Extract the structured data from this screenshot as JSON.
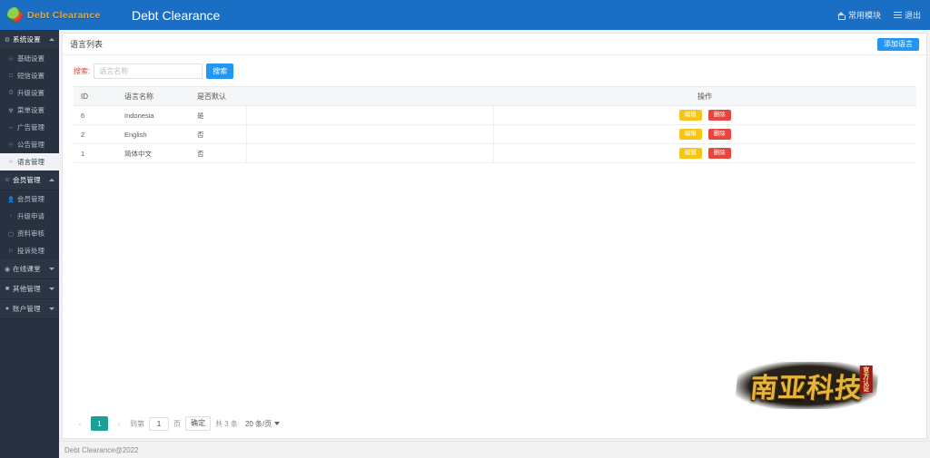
{
  "header": {
    "logo_text": "Debt Clearance",
    "title": "Debt Clearance",
    "nav": [
      {
        "label": "常用模块",
        "icon": "home-icon"
      },
      {
        "label": "退出",
        "icon": "bars-icon"
      }
    ]
  },
  "sidebar": {
    "groups": [
      {
        "label": "系统设置",
        "icon": "wrench-icon",
        "expanded": true,
        "items": [
          {
            "label": "基础设置",
            "icon": "gear-icon",
            "selected": false
          },
          {
            "label": "短信设置",
            "icon": "message-icon",
            "selected": false
          },
          {
            "label": "升级设置",
            "icon": "upgrade-icon",
            "selected": false
          },
          {
            "label": "菜单设置",
            "icon": "menu-icon",
            "selected": false
          },
          {
            "label": "广告管理",
            "icon": "ad-icon",
            "selected": false
          },
          {
            "label": "公告管理",
            "icon": "bell-icon",
            "selected": false
          },
          {
            "label": "语言管理",
            "icon": "globe-icon",
            "selected": true
          }
        ]
      },
      {
        "label": "会员管理",
        "icon": "user-icon",
        "expanded": true,
        "items": [
          {
            "label": "会员管理",
            "icon": "people-icon",
            "selected": false
          },
          {
            "label": "升级申请",
            "icon": "arrow-up-icon",
            "selected": false
          },
          {
            "label": "资料审核",
            "icon": "doc-icon",
            "selected": false
          },
          {
            "label": "投诉处理",
            "icon": "flag-icon",
            "selected": false
          }
        ]
      },
      {
        "label": "在线课堂",
        "icon": "play-icon",
        "expanded": false,
        "items": []
      },
      {
        "label": "其他管理",
        "icon": "grid-icon",
        "expanded": false,
        "items": []
      },
      {
        "label": "账户管理",
        "icon": "circle-icon",
        "expanded": false,
        "items": []
      }
    ]
  },
  "panel": {
    "title": "语言列表",
    "add_button": "添加语言"
  },
  "search": {
    "label": "搜索:",
    "placeholder": "语言名称",
    "value": "",
    "button": "搜索"
  },
  "table": {
    "columns": [
      "ID",
      "语言名称",
      "是否默认",
      "",
      "操作"
    ],
    "rows": [
      {
        "id": "6",
        "name": "Indonesia",
        "is_default": "是",
        "edit": "编辑",
        "delete": "删除"
      },
      {
        "id": "2",
        "name": "English",
        "is_default": "否",
        "edit": "编辑",
        "delete": "删除"
      },
      {
        "id": "1",
        "name": "简体中文",
        "is_default": "否",
        "edit": "编辑",
        "delete": "删除"
      }
    ]
  },
  "pagination": {
    "prev": "‹",
    "next": "›",
    "current_page": "1",
    "goto_prefix": "到第",
    "goto_value": "1",
    "goto_suffix": "页",
    "confirm": "确定",
    "total_text": "共 3 条",
    "page_size": "20 条/页"
  },
  "watermark": {
    "text": "南亚科技",
    "tag": "官方认证"
  },
  "footer": {
    "text": "Debt Clearance@2022"
  },
  "colors": {
    "header_blue": "#1a6fc4",
    "primary_blue": "#2196f3",
    "sidebar_dark": "#27313f",
    "edit_yellow": "#f5c518",
    "delete_red": "#e8453c",
    "page_teal": "#1aa094"
  }
}
